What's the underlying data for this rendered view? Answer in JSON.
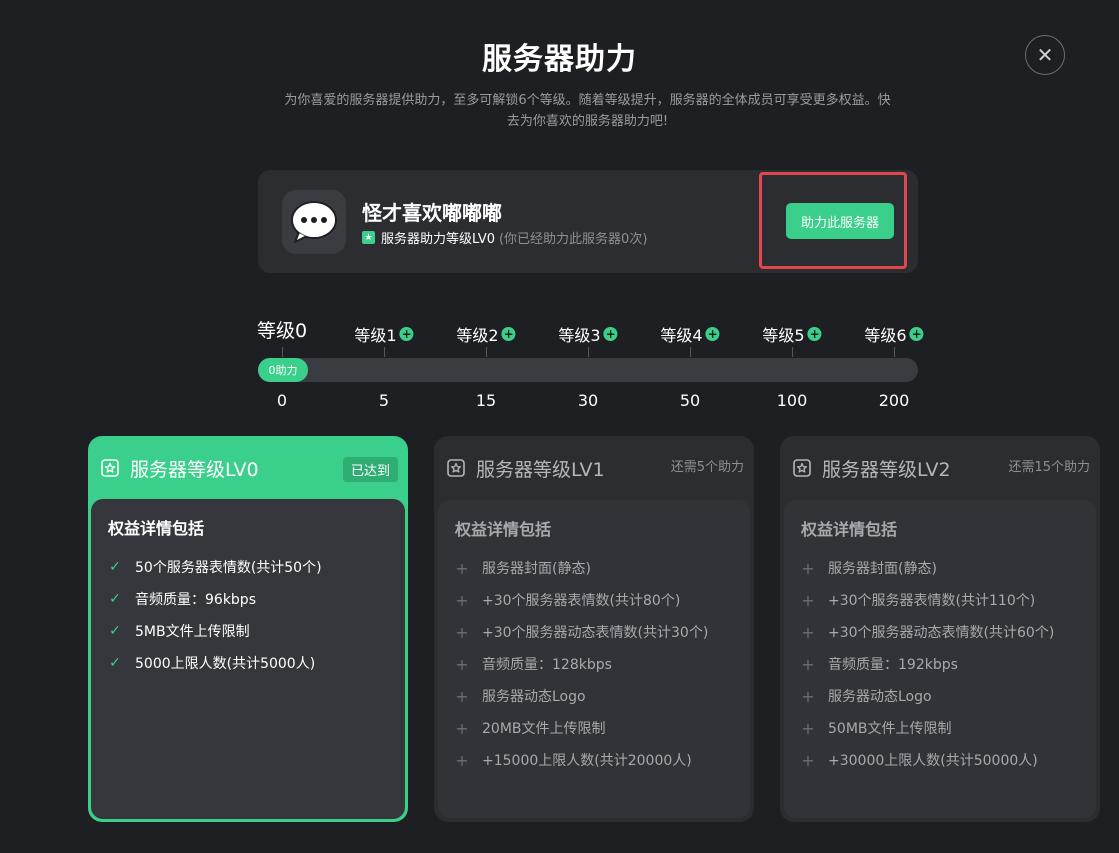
{
  "dialog": {
    "title": "服务器助力",
    "subtitle_line1": "为你喜爱的服务器提供助力，至多可解锁6个等级。随着等级提升，服务器的全体成员可享受更多权益。快",
    "subtitle_line2": "去为你喜欢的服务器助力吧!",
    "close_icon": "close-icon"
  },
  "server": {
    "name": "怪才喜欢嘟嘟嘟",
    "level_text": "服务器助力等级LV0",
    "boost_count_text": "(你已经助力此服务器0次)",
    "boost_button_label": "助力此服务器"
  },
  "progress": {
    "current_label": "0助力",
    "current_value": 0,
    "levels": [
      {
        "label": "等级0",
        "threshold": "0"
      },
      {
        "label": "等级1",
        "threshold": "5"
      },
      {
        "label": "等级2",
        "threshold": "15"
      },
      {
        "label": "等级3",
        "threshold": "30"
      },
      {
        "label": "等级4",
        "threshold": "50"
      },
      {
        "label": "等级5",
        "threshold": "100"
      },
      {
        "label": "等级6",
        "threshold": "200"
      }
    ]
  },
  "tiers": [
    {
      "title": "服务器等级LV0",
      "status": "已达到",
      "body_title": "权益详情包括",
      "benefits": [
        "50个服务器表情数(共计50个)",
        "音频质量：96kbps",
        "5MB文件上传限制",
        "5000上限人数(共计5000人)"
      ]
    },
    {
      "title": "服务器等级LV1",
      "status": "还需5个助力",
      "body_title": "权益详情包括",
      "benefits": [
        "服务器封面(静态)",
        "+30个服务器表情数(共计80个)",
        "+30个服务器动态表情数(共计30个)",
        "音频质量：128kbps",
        "服务器动态Logo",
        "20MB文件上传限制",
        "+15000上限人数(共计20000人)"
      ]
    },
    {
      "title": "服务器等级LV2",
      "status": "还需15个助力",
      "body_title": "权益详情包括",
      "benefits": [
        "服务器封面(静态)",
        "+30个服务器表情数(共计110个)",
        "+30个服务器动态表情数(共计60个)",
        "音频质量：192kbps",
        "服务器动态Logo",
        "50MB文件上传限制",
        "+30000上限人数(共计50000人)"
      ]
    }
  ],
  "colors": {
    "background": "#1e1f22",
    "accent": "#3ad08b",
    "highlight": "#e0464d"
  }
}
